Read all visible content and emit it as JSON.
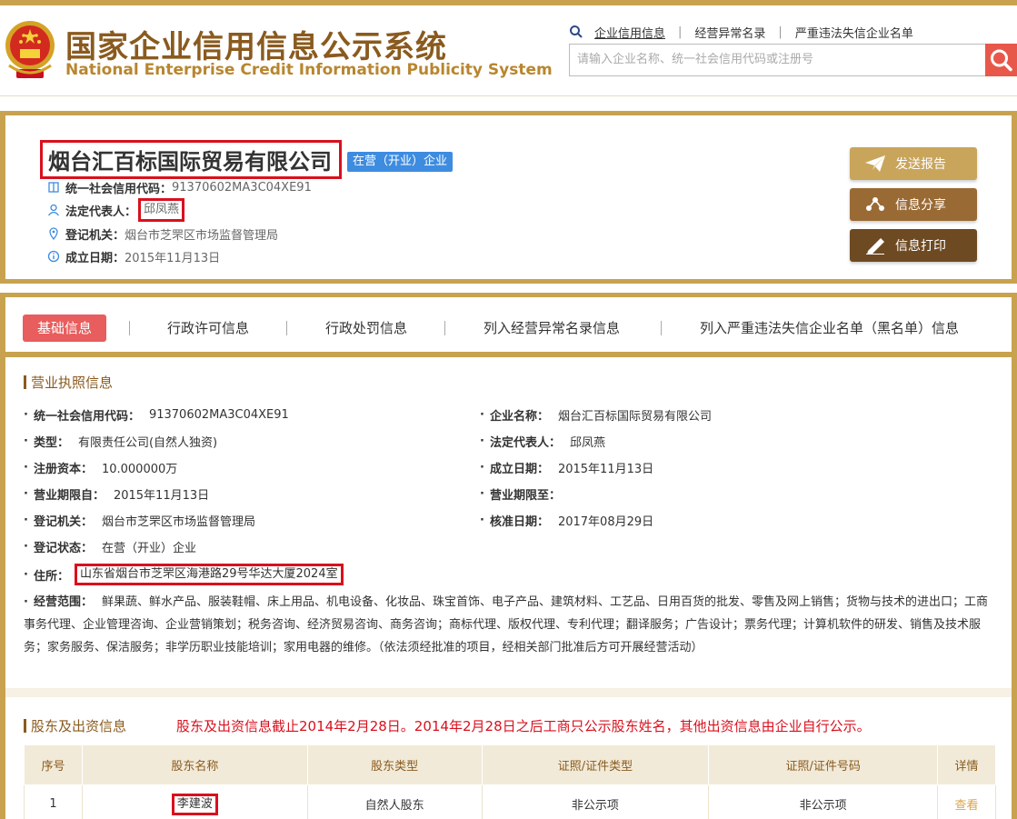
{
  "header": {
    "title_cn": "国家企业信用信息公示系统",
    "title_en": "National Enterprise Credit Information Publicity System",
    "nav": [
      {
        "label": "企业信用信息"
      },
      {
        "label": "经营异常名录"
      },
      {
        "label": "严重违法失信企业名单"
      }
    ],
    "search_placeholder": "请输入企业名称、统一社会信用代码或注册号"
  },
  "company": {
    "name": "烟台汇百标国际贸易有限公司",
    "status": "在营（开业）企业",
    "credit_code_label": "统一社会信用代码：",
    "credit_code": "91370602MA3C04XE91",
    "rep_label": "法定代表人：",
    "rep": "邱凤燕",
    "authority_label": "登记机关：",
    "authority": "烟台市芝罘区市场监督管理局",
    "founded_label": "成立日期：",
    "founded": "2015年11月13日"
  },
  "actions": {
    "report": "发送报告",
    "share": "信息分享",
    "print": "信息打印"
  },
  "tabs": [
    {
      "label": "基础信息"
    },
    {
      "label": "行政许可信息"
    },
    {
      "label": "行政处罚信息"
    },
    {
      "label": "列入经营异常名录信息"
    },
    {
      "label": "列入严重违法失信企业名单（黑名单）信息"
    }
  ],
  "license": {
    "title": "营业执照信息",
    "fields": {
      "credit_code": {
        "k": "统一社会信用代码：",
        "v": "91370602MA3C04XE91"
      },
      "name": {
        "k": "企业名称：",
        "v": "烟台汇百标国际贸易有限公司"
      },
      "type": {
        "k": "类型：",
        "v": "有限责任公司(自然人独资)"
      },
      "rep": {
        "k": "法定代表人：",
        "v": "邱凤燕"
      },
      "capital": {
        "k": "注册资本：",
        "v": "10.000000万"
      },
      "founded": {
        "k": "成立日期：",
        "v": "2015年11月13日"
      },
      "term_from": {
        "k": "营业期限自：",
        "v": "2015年11月13日"
      },
      "term_to": {
        "k": "营业期限至：",
        "v": ""
      },
      "authority": {
        "k": "登记机关：",
        "v": "烟台市芝罘区市场监督管理局"
      },
      "approved": {
        "k": "核准日期：",
        "v": "2017年08月29日"
      },
      "reg_status": {
        "k": "登记状态：",
        "v": "在营（开业）企业"
      },
      "address": {
        "k": "住所：",
        "v": "山东省烟台市芝罘区海港路29号华达大厦2024室"
      },
      "scope": {
        "k": "经营范围：",
        "v": "鲜果蔬、鲜水产品、服装鞋帽、床上用品、机电设备、化妆品、珠宝首饰、电子产品、建筑材料、工艺品、日用百货的批发、零售及网上销售；货物与技术的进出口；工商事务代理、企业管理咨询、企业营销策划；税务咨询、经济贸易咨询、商务咨询；商标代理、版权代理、专利代理；翻译服务；广告设计；票务代理；计算机软件的研发、销售及技术服务；家务服务、保洁服务；非学历职业技能培训；家用电器的维修。（依法须经批准的项目，经相关部门批准后方可开展经营活动）"
      }
    }
  },
  "shareholders": {
    "title": "股东及出资信息",
    "notice": "股东及出资信息截止2014年2月28日。2014年2月28日之后工商只公示股东姓名，其他出资信息由企业自行公示。",
    "columns": [
      "序号",
      "股东名称",
      "股东类型",
      "证照/证件类型",
      "证照/证件号码",
      "详情"
    ],
    "rows": [
      {
        "no": "1",
        "name": "李建波",
        "type": "自然人股东",
        "id_type": "非公示项",
        "id_no": "非公示项",
        "detail": "查看"
      }
    ]
  }
}
